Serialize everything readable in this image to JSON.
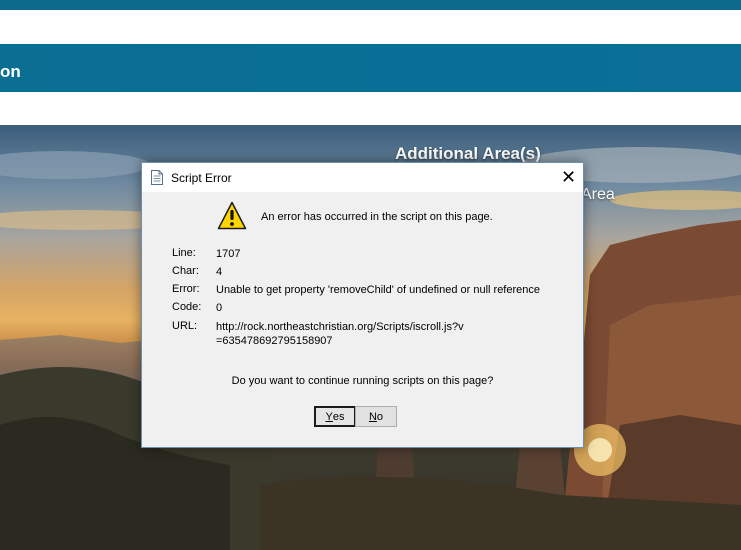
{
  "page": {
    "header_title_fragment": "on",
    "area_heading": "Additional Area(s)",
    "area_sub_fragment": "Area"
  },
  "dialog": {
    "title": "Script Error",
    "close_glyph": "✕",
    "message": "An error has occurred in the script on this page.",
    "rows": [
      {
        "label": "Line:",
        "value": "1707"
      },
      {
        "label": "Char:",
        "value": "4"
      },
      {
        "label": "Error:",
        "value": "Unable to get property 'removeChild' of undefined or null reference"
      },
      {
        "label": "Code:",
        "value": "0"
      },
      {
        "label": "URL:",
        "value": "http://rock.northeastchristian.org/Scripts/iscroll.js?v=635478692795158907"
      }
    ],
    "question": "Do you want to continue running scripts on this page?",
    "buttons": {
      "yes_mnemonic": "Y",
      "yes_rest": "es",
      "no_mnemonic": "N",
      "no_rest": "o"
    }
  },
  "colors": {
    "brand_blue": "#0b6e93",
    "dialog_bg": "#f0f0f0",
    "dialog_border": "#6b8fb3",
    "warning_yellow": "#ffd400"
  },
  "icons": {
    "title": "document-icon",
    "warning": "warning-icon",
    "close": "close-icon"
  }
}
